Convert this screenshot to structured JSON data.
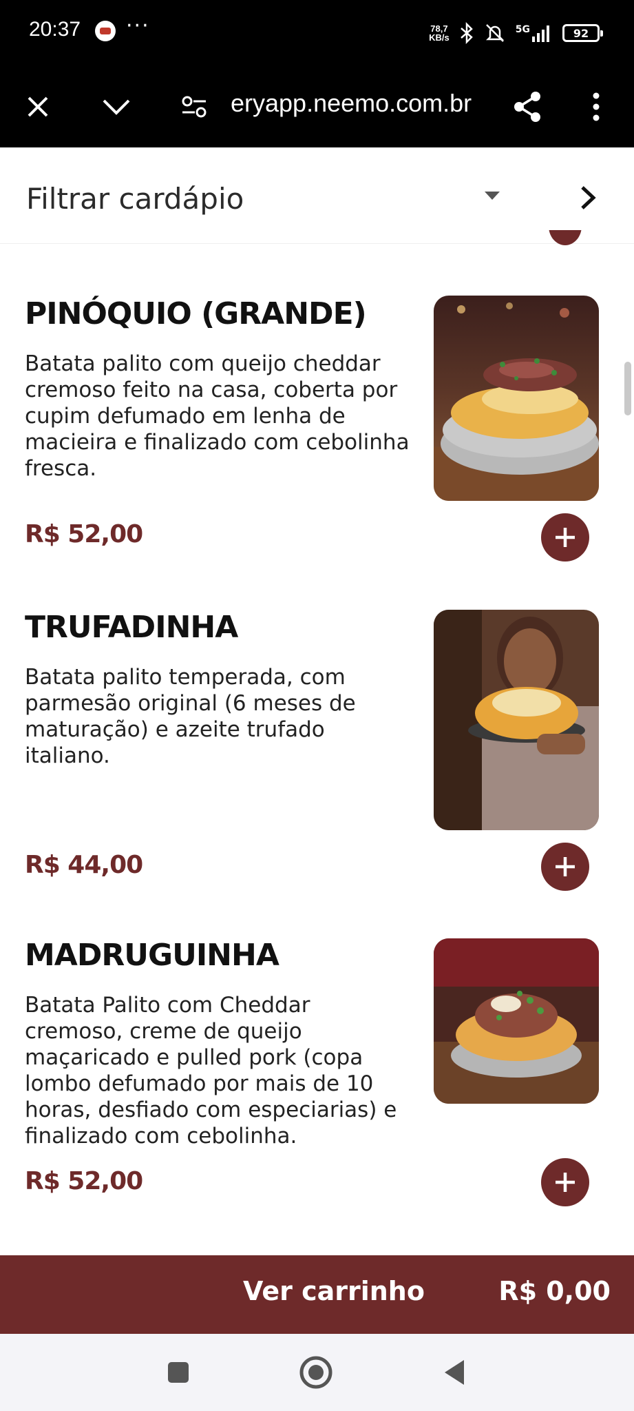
{
  "status_bar": {
    "time": "20:37",
    "more": "···",
    "net_speed_value": "78,7",
    "net_speed_unit": "KB/s",
    "network": "5G",
    "battery": "92"
  },
  "browser": {
    "url": "eryapp.neemo.com.br"
  },
  "filter": {
    "label": "Filtrar cardápio"
  },
  "items": [
    {
      "name": "PINÓQUIO (GRANDE)",
      "description": "Batata palito com queijo cheddar cremoso feito na casa, coberta por cupim defumado em lenha de macieira e finalizado com cebolinha fresca.",
      "price": "R$ 52,00"
    },
    {
      "name": "TRUFADINHA",
      "description": "Batata palito temperada, com parmesão original (6 meses de maturação) e azeite trufado italiano.",
      "price": "R$ 44,00"
    },
    {
      "name": "MADRUGUINHA",
      "description": "Batata Palito com Cheddar cremoso, creme de queijo maçaricado e pulled pork (copa lombo defumado por mais de 10 horas, desfiado com especiarias) e finalizado com cebolinha.",
      "price": "R$ 52,00"
    }
  ],
  "cart": {
    "label": "Ver carrinho",
    "total": "R$ 0,00"
  },
  "colors": {
    "brand": "#6e2a2a",
    "status_bar": "#000000"
  }
}
